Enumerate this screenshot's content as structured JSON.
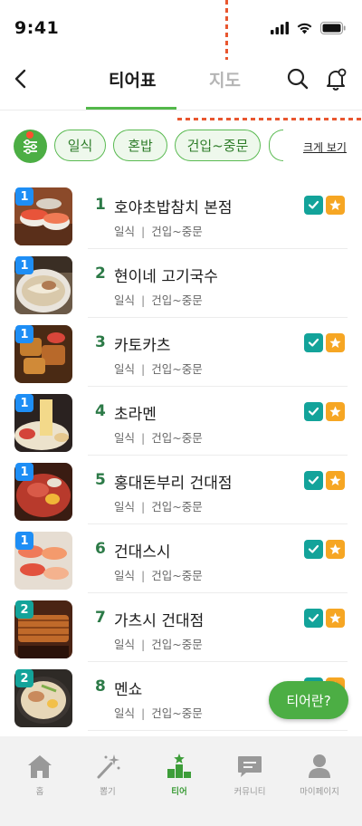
{
  "status_bar": {
    "time": "9:41"
  },
  "header": {
    "tabs": [
      {
        "label": "티어표",
        "active": true
      },
      {
        "label": "지도",
        "active": false
      }
    ]
  },
  "filters": {
    "chips": [
      "일식",
      "혼밥",
      "건입~중문"
    ],
    "partial_chip": "",
    "big_view": "크게 보기"
  },
  "restaurants": [
    {
      "tier": "1",
      "rank": "1",
      "name": "호야초밥참치 본점",
      "category": "일식",
      "area": "건입~중문",
      "icons": true
    },
    {
      "tier": "1",
      "rank": "2",
      "name": "현이네 고기국수",
      "category": "일식",
      "area": "건입~중문",
      "icons": false
    },
    {
      "tier": "1",
      "rank": "3",
      "name": "카토카츠",
      "category": "일식",
      "area": "건입~중문",
      "icons": true
    },
    {
      "tier": "1",
      "rank": "4",
      "name": "초라멘",
      "category": "일식",
      "area": "건입~중문",
      "icons": true
    },
    {
      "tier": "1",
      "rank": "5",
      "name": "홍대돈부리 건대점",
      "category": "일식",
      "area": "건입~중문",
      "icons": true
    },
    {
      "tier": "1",
      "rank": "6",
      "name": "건대스시",
      "category": "일식",
      "area": "건입~중문",
      "icons": true
    },
    {
      "tier": "2",
      "rank": "7",
      "name": "가츠시 건대점",
      "category": "일식",
      "area": "건입~중문",
      "icons": true
    },
    {
      "tier": "2",
      "rank": "8",
      "name": "멘쇼",
      "category": "일식",
      "area": "건입~중문",
      "icons": true
    }
  ],
  "meta_separator": "|",
  "fab": {
    "label": "티어란?"
  },
  "bottom_nav": [
    {
      "label": "홈",
      "icon": "home-icon"
    },
    {
      "label": "뽑기",
      "icon": "magic-wand-icon"
    },
    {
      "label": "티어",
      "icon": "podium-icon",
      "active": true
    },
    {
      "label": "커뮤니티",
      "icon": "chat-icon"
    },
    {
      "label": "마이페이지",
      "icon": "person-icon"
    }
  ],
  "colors": {
    "brand_green": "#4cae44",
    "tier1_badge": "#1e8ef5",
    "tier2_badge": "#13a39a",
    "check": "#13a39a",
    "star": "#f6a623",
    "annotation_red": "#e8562f"
  }
}
